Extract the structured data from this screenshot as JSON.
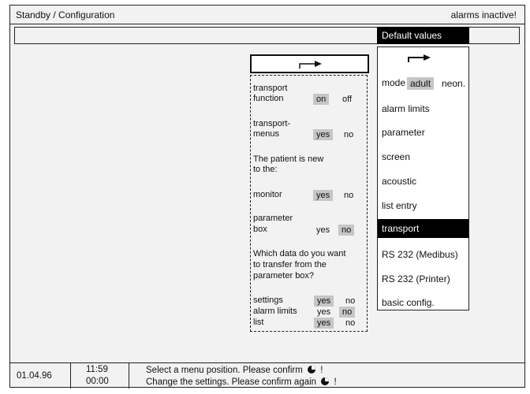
{
  "header": {
    "title": "Standby / Configuration",
    "alarm_status": "alarms inactive!"
  },
  "menu": {
    "header": "Default values",
    "mode_label": "mode",
    "mode_options": [
      "adult",
      "neon."
    ],
    "items": [
      "alarm limits",
      "parameter",
      "screen",
      "acoustic",
      "list entry",
      "transport",
      "RS 232 (Medibus)",
      "RS 232 (Printer)",
      "basic config."
    ],
    "selected": "transport"
  },
  "transport_panel": {
    "transport_function_label1": "transport",
    "transport_function_label2": "function",
    "transport_function_on": "on",
    "transport_function_off": "off",
    "transport_menus_label1": "transport-",
    "transport_menus_label2": "menus",
    "transport_menus_yes": "yes",
    "transport_menus_no": "no",
    "patient_new_line1": "The patient is new",
    "patient_new_line2": "to the:",
    "monitor_label": "monitor",
    "monitor_yes": "yes",
    "monitor_no": "no",
    "param_box_label1": "parameter",
    "param_box_label2": "box",
    "param_box_yes": "yes",
    "param_box_no": "no",
    "transfer_q_line1": "Which data do you want",
    "transfer_q_line2": "to transfer from the",
    "transfer_q_line3": "parameter box?",
    "settings_label": "settings",
    "settings_yes": "yes",
    "settings_no": "no",
    "alarm_limits_label": "alarm limits",
    "alarm_limits_yes": "yes",
    "alarm_limits_no": "no",
    "list_label": "list",
    "list_yes": "yes",
    "list_no": "no"
  },
  "status_bar": {
    "date": "01.04.96",
    "time1": "11:59",
    "time2": "00:00",
    "msg1_a": "Select a menu position. Please confirm",
    "msg1_b": "!",
    "msg2_a": "Change the settings. Please confirm again",
    "msg2_b": "!"
  },
  "icons": {
    "arrow": "right-turn-arrow-icon",
    "confirm": "rotary-knob-icon"
  }
}
